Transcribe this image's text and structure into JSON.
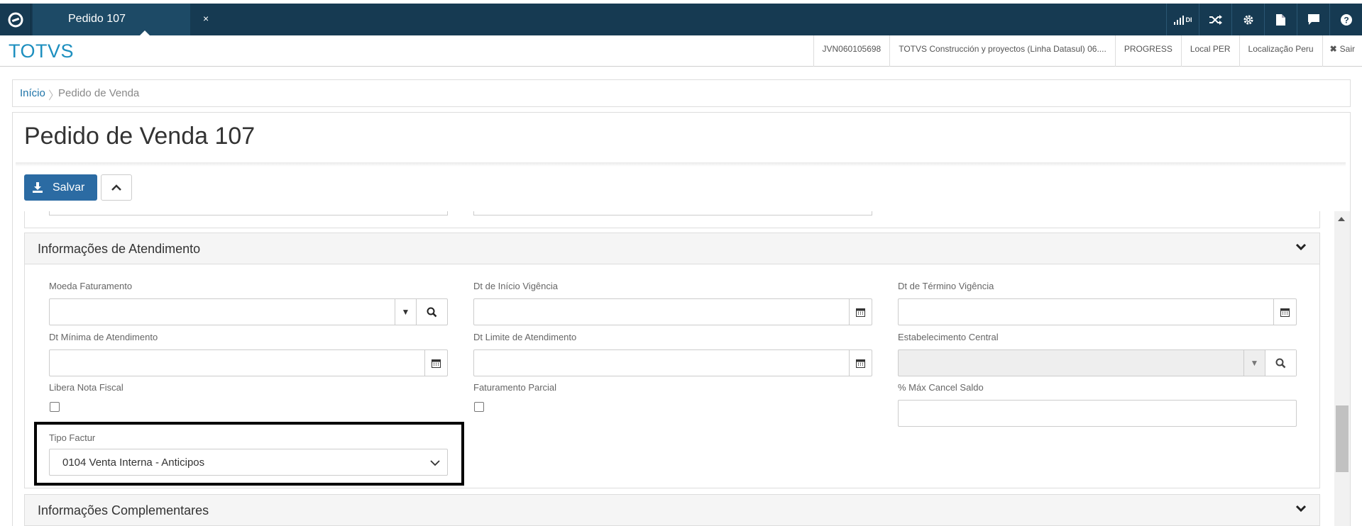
{
  "topbar": {
    "tab_label": "Pedido 107",
    "tab_close": "×",
    "di_label": "DI"
  },
  "header": {
    "brand": "TOTVS",
    "items": [
      "JVN060105698",
      "TOTVS Construcción y proyectos (Linha Datasul) 06....",
      "PROGRESS",
      "Local PER",
      "Localização Peru"
    ],
    "logout": "Sair"
  },
  "breadcrumb": {
    "home": "Início",
    "separator": "〉",
    "current": "Pedido de Venda"
  },
  "page": {
    "title": "Pedido de Venda 107",
    "save_label": "Salvar"
  },
  "section_atendimento": {
    "title": "Informações de Atendimento",
    "fields": {
      "moeda": "Moeda Faturamento",
      "dt_inicio": "Dt de Início Vigência",
      "dt_termino": "Dt de Término Vigência",
      "dt_minima": "Dt Mínima de Atendimento",
      "dt_limite": "Dt Limite de Atendimento",
      "estab": "Estabelecimento Central",
      "libera_nf": "Libera Nota Fiscal",
      "fat_parcial": "Faturamento Parcial",
      "max_cancel": "% Máx Cancel Saldo",
      "tipo_factur": "Tipo Factur"
    },
    "tipo_factur_value": "0104 Venta Interna - Anticipos"
  },
  "section_complementares": {
    "title": "Informações Complementares"
  }
}
